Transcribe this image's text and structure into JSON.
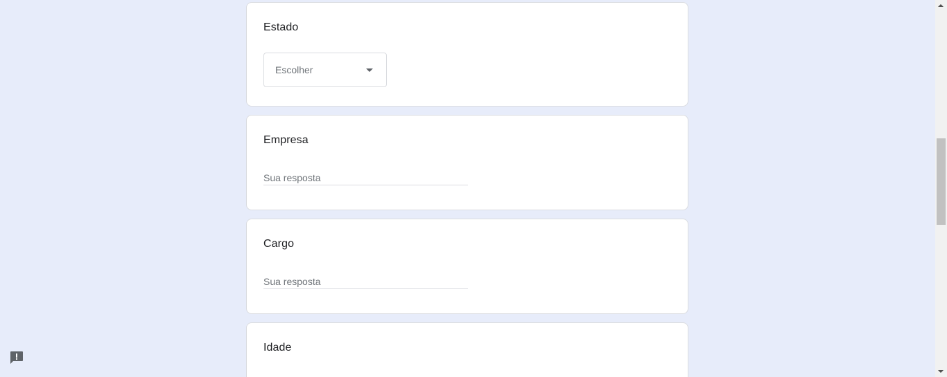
{
  "form": {
    "estado": {
      "title": "Estado",
      "dropdown_value": "Escolher"
    },
    "empresa": {
      "title": "Empresa",
      "placeholder": "Sua resposta"
    },
    "cargo": {
      "title": "Cargo",
      "placeholder": "Sua resposta"
    },
    "idade": {
      "title": "Idade"
    }
  },
  "icons": {
    "dropdown": "triangle-down-icon",
    "feedback": "feedback-icon"
  },
  "colors": {
    "background": "#e7ecfa",
    "card": "#ffffff",
    "border": "#dadce0"
  }
}
